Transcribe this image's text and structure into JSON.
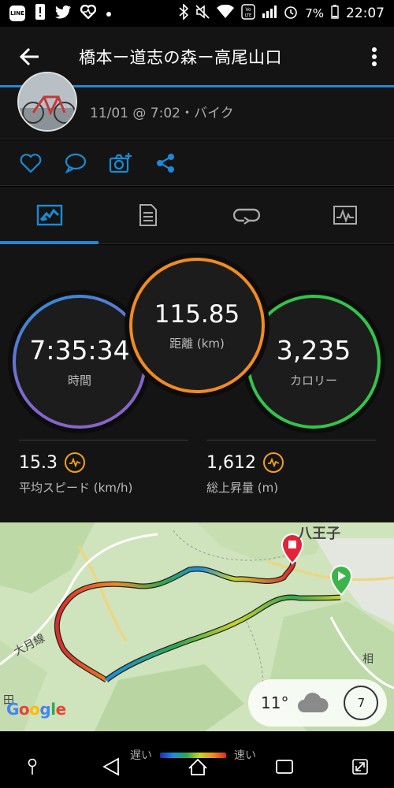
{
  "status_bar": {
    "badge_label": "LINE",
    "battery": "7%",
    "time": "22:07",
    "icons": [
      "line-icon",
      "alert-icon",
      "twitter-icon",
      "heart-rate-icon",
      "dot-icon",
      "bluetooth-icon",
      "mute-icon",
      "wifi-icon",
      "volte-icon",
      "signal-icon",
      "alarm-icon",
      "battery-icon"
    ]
  },
  "app_bar": {
    "title": "橋本ー道志の森ー高尾山口"
  },
  "activity": {
    "meta": "11/01 @ 7:02・バイク"
  },
  "tabs": [
    "summary-tab",
    "details-tab",
    "laps-tab",
    "graphs-tab"
  ],
  "stats": {
    "time": {
      "value": "7:35:34",
      "label": "時間"
    },
    "distance": {
      "value": "115.85",
      "label": "距離 (km)"
    },
    "calories": {
      "value": "3,235",
      "label": "カロリー"
    },
    "avg_speed": {
      "value": "15.3",
      "label": "平均スピード (km/h)"
    },
    "total_ascent": {
      "value": "1,612",
      "label": "総上昇量 (m)"
    }
  },
  "map": {
    "city_label": "八王子",
    "line_label": "大月線",
    "side_label_1": "相",
    "side_label_2": "田",
    "google": "Google",
    "weather_temp": "11°",
    "wind_speed": "7"
  },
  "legend": {
    "slow": "遅い",
    "fast": "速い"
  },
  "colors": {
    "accent": "#1b8bd6",
    "time_ring": "#7d6ad0",
    "distance_ring": "#f08b25",
    "calorie_ring": "#35c34b",
    "pulse": "#f0a020"
  }
}
